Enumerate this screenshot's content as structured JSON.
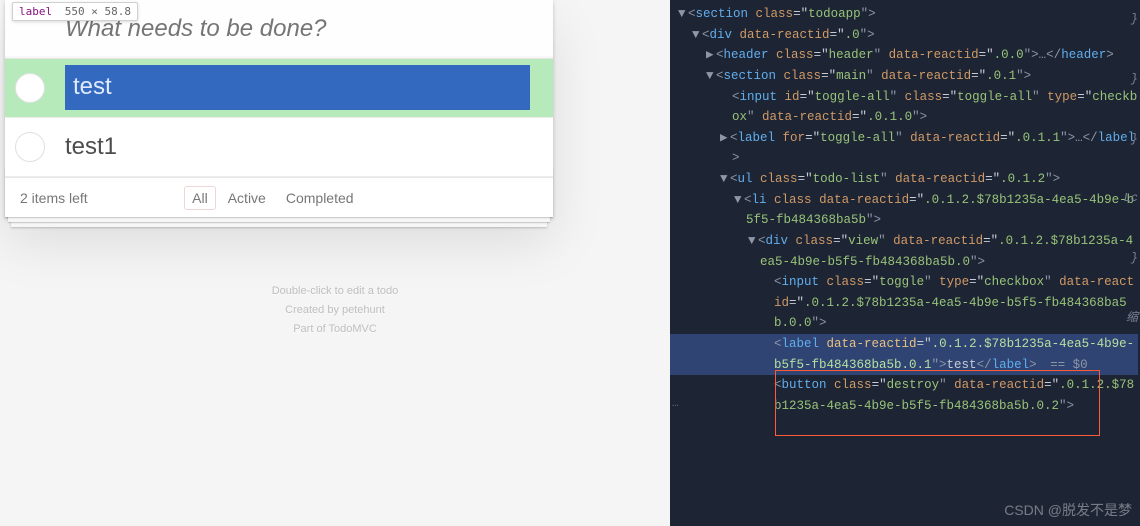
{
  "badge": {
    "tag": "label",
    "dims": "550 × 58.8"
  },
  "app": {
    "placeholder": "What needs to be done?",
    "todos": [
      {
        "text": "test",
        "highlighted": true
      },
      {
        "text": "test1",
        "highlighted": false
      }
    ],
    "footer": {
      "count": "2 items left",
      "filters": {
        "all": "All",
        "active": "Active",
        "completed": "Completed"
      }
    },
    "info": {
      "l1": "Double-click to edit a todo",
      "l2": "Created by petehunt",
      "l3": "Part of TodoMVC"
    }
  },
  "dev": {
    "gutter_dots": "…",
    "l0": {
      "caret": "▼",
      "pre": "<",
      "tag": "section",
      "post": " ",
      "a1n": "class",
      "eq": "=\"",
      "a1v": "todoapp",
      "close": "\">"
    },
    "l1": {
      "caret": "▼",
      "pre": "<",
      "tag": "div",
      "post": " ",
      "a1n": "data-reactid",
      "eq": "=\"",
      "a1v": ".0",
      "close": "\">"
    },
    "l2": {
      "caret": "▶",
      "pre": "<",
      "tag": "header",
      "post": " ",
      "a1n": "class",
      "eq": "=\"",
      "a1v": "header",
      "mid": "\" ",
      "a2n": "data-reactid",
      "eq2": "=\"",
      "a2v": ".0.0",
      "close": "\">…"
    },
    "l2b": {
      "pre": "</",
      "tag": "header",
      "close": ">"
    },
    "l3": {
      "caret": "▼",
      "pre": "<",
      "tag": "section",
      "post": " ",
      "a1n": "class",
      "eq": "=\"",
      "a1v": "main",
      "mid": "\" ",
      "a2n": "data-reactid",
      "eq2": "=\"",
      "a2v": ".0.1",
      "close": "\">"
    },
    "l4": {
      "pre": "<",
      "tag": "input",
      "post": " ",
      "a1n": "id",
      "eq": "=\"",
      "a1v": "toggle-all",
      "mid": "\" ",
      "a2n": "class",
      "eq2": "=\"",
      "a2v": "toggle-all",
      "mid2": "\" ",
      "a3n": "type",
      "eq3": "=\"",
      "a3v": "checkbox",
      "mid3": "\" ",
      "a4n": "data-reactid",
      "eq4": "=\"",
      "a4v": ".0.1.0",
      "close": "\">"
    },
    "l5": {
      "caret": "▶",
      "pre": "<",
      "tag": "label",
      "post": " ",
      "a1n": "for",
      "eq": "=\"",
      "a1v": "toggle-all",
      "mid": "\" ",
      "a2n": "data-reactid",
      "eq2": "=\"",
      "a2v": ".0.1.1",
      "close": "\">…</",
      "tag2": "label",
      "close2": ">"
    },
    "l6": {
      "caret": "▼",
      "pre": "<",
      "tag": "ul",
      "post": " ",
      "a1n": "class",
      "eq": "=\"",
      "a1v": "todo-list",
      "mid": "\" ",
      "a2n": "data-reactid",
      "eq2": "=\"",
      "a2v": ".0.1.2",
      "close": "\">"
    },
    "l7": {
      "caret": "▼",
      "pre": "<",
      "tag": "li",
      "post": " ",
      "a1n": "class",
      "post2": " ",
      "a2n": "data-reactid",
      "eq2": "=\"",
      "a2v": ".0.1.2.$78b1235a-4ea5-4b9e-b5f5-fb484368ba5b",
      "close": "\">"
    },
    "l8": {
      "caret": "▼",
      "pre": "<",
      "tag": "div",
      "post": " ",
      "a1n": "class",
      "eq": "=\"",
      "a1v": "view",
      "mid": "\" ",
      "a2n": "data-reactid",
      "eq2": "=\"",
      "a2v": ".0.1.2.$78b1235a-4ea5-4b9e-b5f5-fb484368ba5b.0",
      "close": "\">"
    },
    "l9": {
      "pre": "<",
      "tag": "input",
      "post": " ",
      "a1n": "class",
      "eq": "=\"",
      "a1v": "toggle",
      "mid": "\" ",
      "a2n": "type",
      "eq2": "=\"",
      "a2v": "checkbox",
      "mid2": "\" ",
      "a3n": "data-reactid",
      "eq3": "=\"",
      "a3v": ".0.1.2.$78b1235a-4ea5-4b9e-b5f5-fb484368ba5b.0.0",
      "close": "\">"
    },
    "l10": {
      "pre": "<",
      "tag": "label",
      "post": " ",
      "a1n": "data-reactid",
      "eq": "=\"",
      "a1v": ".0.1.2.$78b1235a-4ea5-4b9e-b5f5-fb484368ba5b.0.1",
      "close": "\">"
    },
    "l10b": {
      "txt": "test",
      "pre": "</",
      "tag": "label",
      "close": ">",
      "extra": " == $0"
    },
    "l11": {
      "pre": "<",
      "tag": "button",
      "post": " ",
      "a1n": "class",
      "eq": "=\"",
      "a1v": "destroy",
      "mid": "\" ",
      "a2n": "data-reactid",
      "eq2": "=\"",
      "a2v": ".0.1.2.$78b1235a-4ea5-4b9e-b5f5-fb484368ba5b.0.2",
      "close": "\">"
    },
    "side_hints": [
      "}",
      "}",
      "}",
      "Lc",
      "}",
      "缩"
    ]
  },
  "watermark": "CSDN @脱发不是梦"
}
